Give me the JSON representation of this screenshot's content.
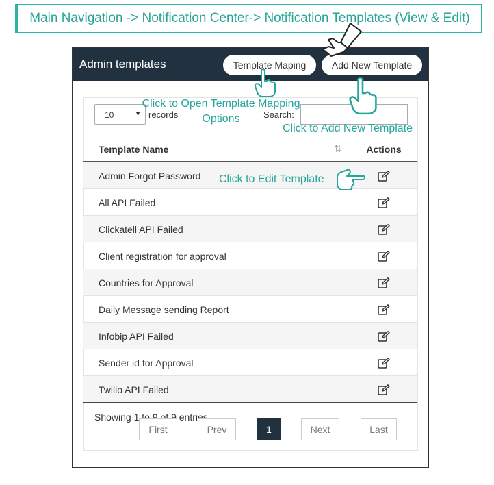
{
  "breadcrumb": "Main Navigation -> Notification Center-> Notification Templates (View & Edit)",
  "panel": {
    "title": "Admin templates",
    "mapping_button": "Template Maping",
    "add_button": "Add New Template"
  },
  "controls": {
    "length_value": "10",
    "records_label": "records",
    "search_label": "Search:",
    "search_value": ""
  },
  "table": {
    "columns": [
      "Template Name",
      "Actions"
    ],
    "rows": [
      "Admin Forgot Password",
      "All API Failed",
      "Clickatell API Failed",
      "Client registration for approval",
      "Countries for Approval",
      "Daily Message sending Report",
      "Infobip API Failed",
      "Sender id for Approval",
      "Twilio API Failed"
    ]
  },
  "pagination": {
    "info": "Showing 1 to 9 of 9 entries",
    "first": "First",
    "prev": "Prev",
    "current": "1",
    "next": "Next",
    "last": "Last"
  },
  "annotations": {
    "mapping": "Click to Open Template Mapping Options",
    "add": "Click to Add New Template",
    "edit": "Click to Edit Template"
  },
  "colors": {
    "accent": "#26a69a",
    "header_bg": "#22313f"
  },
  "icons": {
    "edit": "edit-icon",
    "pointer": "hand-pointer-icon",
    "sort": "sort-icon"
  }
}
